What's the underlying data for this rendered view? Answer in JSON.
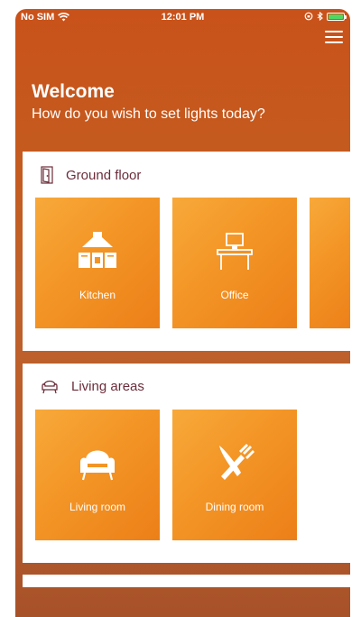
{
  "status_bar": {
    "carrier": "No SIM",
    "time": "12:01 PM"
  },
  "welcome": {
    "title": "Welcome",
    "subtitle": "How do you wish to set lights today?"
  },
  "zones": [
    {
      "name": "Ground floor",
      "icon": "door-icon",
      "rooms": [
        {
          "label": "Kitchen",
          "icon": "kitchen-icon"
        },
        {
          "label": "Office",
          "icon": "office-desk-icon"
        },
        {
          "label": "",
          "icon": ""
        }
      ]
    },
    {
      "name": "Living areas",
      "icon": "armchair-outline-icon",
      "rooms": [
        {
          "label": "Living room",
          "icon": "armchair-icon"
        },
        {
          "label": "Dining room",
          "icon": "fork-knife-icon"
        }
      ]
    }
  ],
  "colors": {
    "accent": "#f39526",
    "header_text": "#6b2d3a",
    "background": "#c55a1e"
  }
}
